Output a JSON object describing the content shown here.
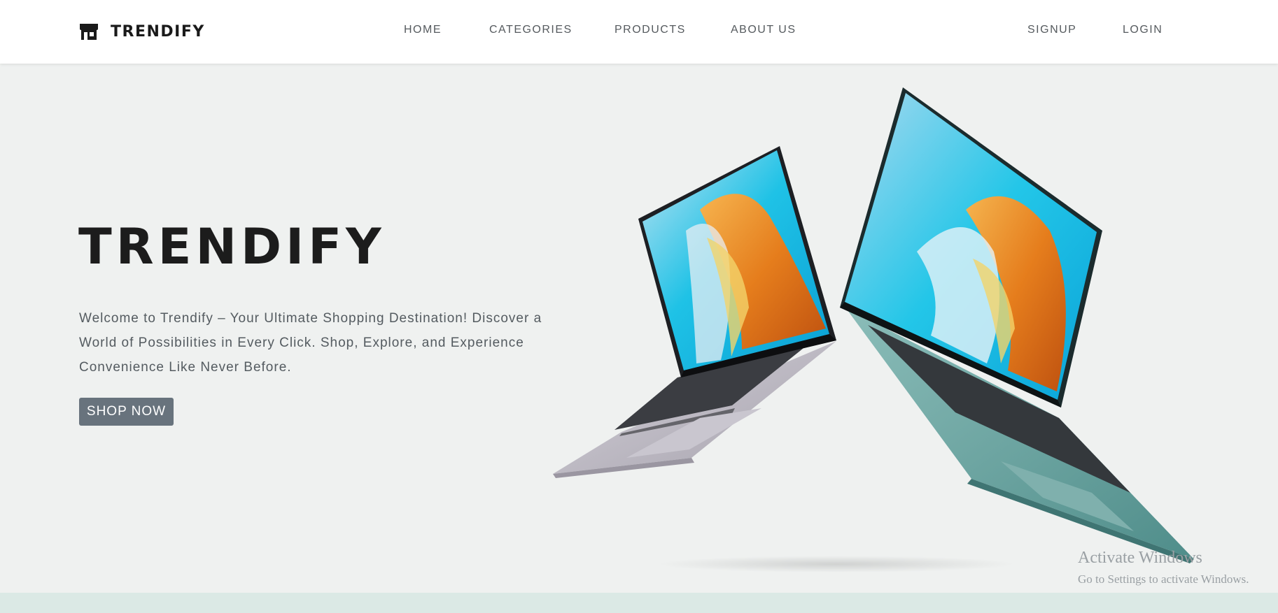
{
  "header": {
    "brand": "TRENDIFY",
    "brand_icon": "store-icon",
    "nav": {
      "home": "HOME",
      "categories": "CATEGORIES",
      "products": "PRODUCTS",
      "about": "ABOUT US"
    },
    "auth": {
      "signup": "SIGNUP",
      "login": "LOGIN"
    }
  },
  "hero": {
    "title": "TRENDIFY",
    "text": "Welcome to Trendify – Your Ultimate Shopping Destination! Discover a World of Possibilities in Every Click. Shop, Explore, and Experience Convenience Like Never Before.",
    "button": "SHOP NOW",
    "image_alt": "two-laptops-image"
  },
  "watermark": {
    "title": "Activate Windows",
    "subtitle": "Go to Settings to activate Windows."
  },
  "colors": {
    "background": "#eff1f0",
    "button": "#68737d",
    "band": "#dbe9e5",
    "laptop_silver": "#bdb9c4",
    "laptop_teal": "#6ea6a3"
  }
}
